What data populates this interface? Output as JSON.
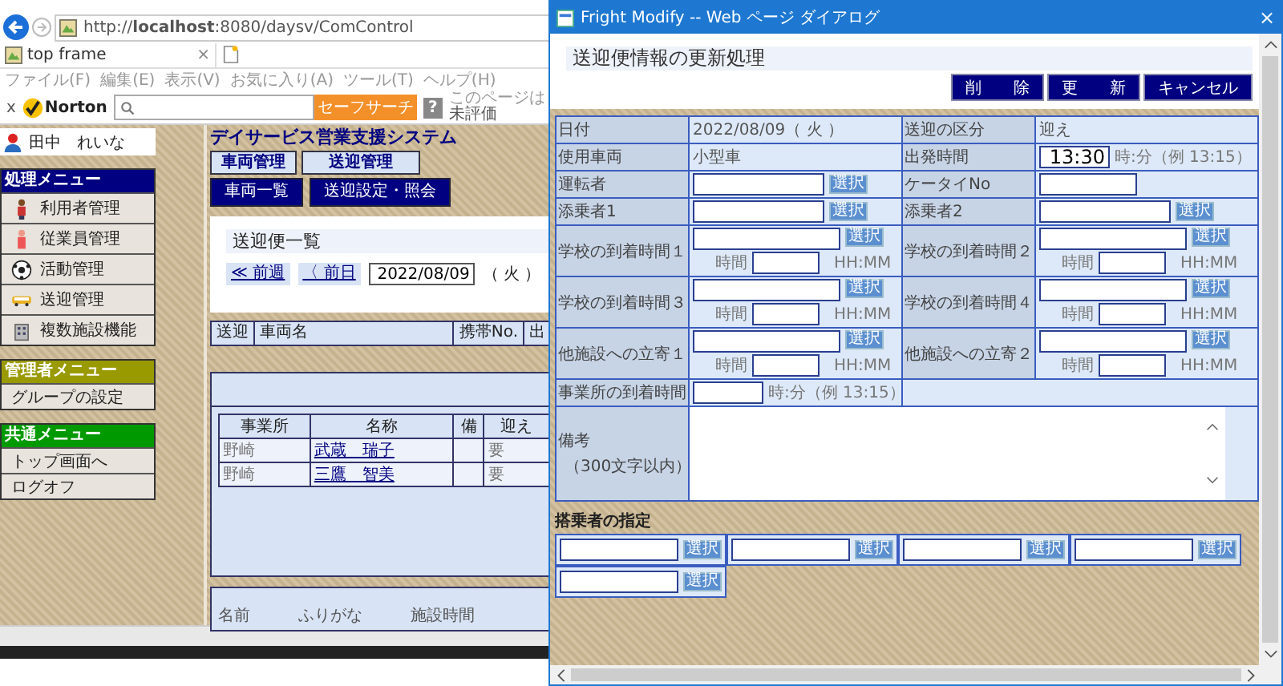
{
  "browser": {
    "address": "http://**localhost**:8080/daysv/ComControl",
    "tab": {
      "title": "top frame",
      "close": "×"
    },
    "menu": [
      "ファイル(F)",
      "編集(E)",
      "表示(V)",
      "お気に入り(A)",
      "ツール(T)",
      "ヘルプ(H)"
    ],
    "norton": {
      "close": "x",
      "brand": "Norton",
      "search_button": "セーフサーチ",
      "help": "?",
      "rating": "このページは",
      "rating_status": "未評価"
    }
  },
  "app": {
    "user": "田中　れいな",
    "title": "デイサービス営業支援システム",
    "menus": [
      {
        "title": "処理メニュー",
        "color": "#000080",
        "items": [
          "利用者管理",
          "従業員管理",
          "活動管理",
          "送迎管理",
          "複数施設機能"
        ]
      },
      {
        "title": "管理者メニュー",
        "color": "#999900",
        "items": [
          "グループの設定"
        ]
      },
      {
        "title": "共通メニュー",
        "color": "#009900",
        "items": [
          "トップ画面へ",
          "ログオフ"
        ]
      }
    ],
    "tabs": [
      "車両管理",
      "送迎管理"
    ],
    "subtabs": [
      "車両一覧",
      "送迎設定・照会"
    ],
    "list_panel": {
      "title": "送迎便一覧",
      "nav": [
        "≪ 前週",
        "〈 前日"
      ],
      "date": "2022/08/09",
      "weekday": "（ 火 ）"
    },
    "trip_table": {
      "columns": [
        "送迎",
        "車両名",
        "携帯No.",
        "出"
      ]
    },
    "passenger_table": {
      "columns": [
        "事業所",
        "名称",
        "備",
        "迎え"
      ],
      "rows": [
        [
          "野崎",
          "武蔵　瑞子",
          "",
          "要"
        ],
        [
          "野崎",
          "三鷹　智美",
          "",
          "要"
        ]
      ]
    },
    "bottom_table": {
      "columns": [
        "名前",
        "ふりがな",
        "施設時間"
      ]
    }
  },
  "dialog": {
    "title": "Fright Modify -- Web ページ ダイアログ",
    "close": "×",
    "heading": "送迎便情報の更新処理",
    "buttons": [
      "削　　除",
      "更　　新",
      "キャンセル"
    ],
    "form": [
      [
        {
          "label": "日付",
          "kind": "text",
          "value": "2022/08/09（ 火 ）"
        },
        {
          "label": "送迎の区分",
          "kind": "text",
          "value": "迎え"
        }
      ],
      [
        {
          "label": "使用車両",
          "kind": "text",
          "value": "小型車"
        },
        {
          "label": "出発時間",
          "kind": "time",
          "value": "13:30",
          "hint": "時:分（例 13:15）"
        }
      ],
      [
        {
          "label": "運転者",
          "kind": "select",
          "button": "選択"
        },
        {
          "label": "ケータイNo",
          "kind": "short"
        }
      ],
      [
        {
          "label": "添乗者1",
          "kind": "select",
          "button": "選択"
        },
        {
          "label": "添乗者2",
          "kind": "select",
          "button": "選択"
        }
      ],
      [
        {
          "label": "学校の到着時間１",
          "kind": "arrival",
          "button": "選択",
          "time_label": "時間",
          "format": "HH:MM"
        },
        {
          "label": "学校の到着時間２",
          "kind": "arrival",
          "button": "選択",
          "time_label": "時間",
          "format": "HH:MM"
        }
      ],
      [
        {
          "label": "学校の到着時間３",
          "kind": "arrival",
          "button": "選択",
          "time_label": "時間",
          "format": "HH:MM"
        },
        {
          "label": "学校の到着時間４",
          "kind": "arrival",
          "button": "選択",
          "time_label": "時間",
          "format": "HH:MM"
        }
      ],
      [
        {
          "label": "他施設への立寄１",
          "kind": "arrival",
          "button": "選択",
          "time_label": "時間",
          "format": "HH:MM"
        },
        {
          "label": "他施設への立寄２",
          "kind": "arrival",
          "button": "選択",
          "time_label": "時間",
          "format": "HH:MM"
        }
      ],
      [
        {
          "label": "事業所の到着時間",
          "kind": "time",
          "hint": "時:分（例 13:15）"
        }
      ]
    ],
    "remarks": {
      "label": "備考",
      "note": "（300文字以内）"
    },
    "riders": {
      "title": "搭乗者の指定",
      "slots": [
        {
          "button": "選択"
        },
        {
          "button": "選択"
        },
        {
          "button": "選択"
        },
        {
          "button": "選択"
        },
        {
          "button": "選択"
        }
      ]
    }
  }
}
